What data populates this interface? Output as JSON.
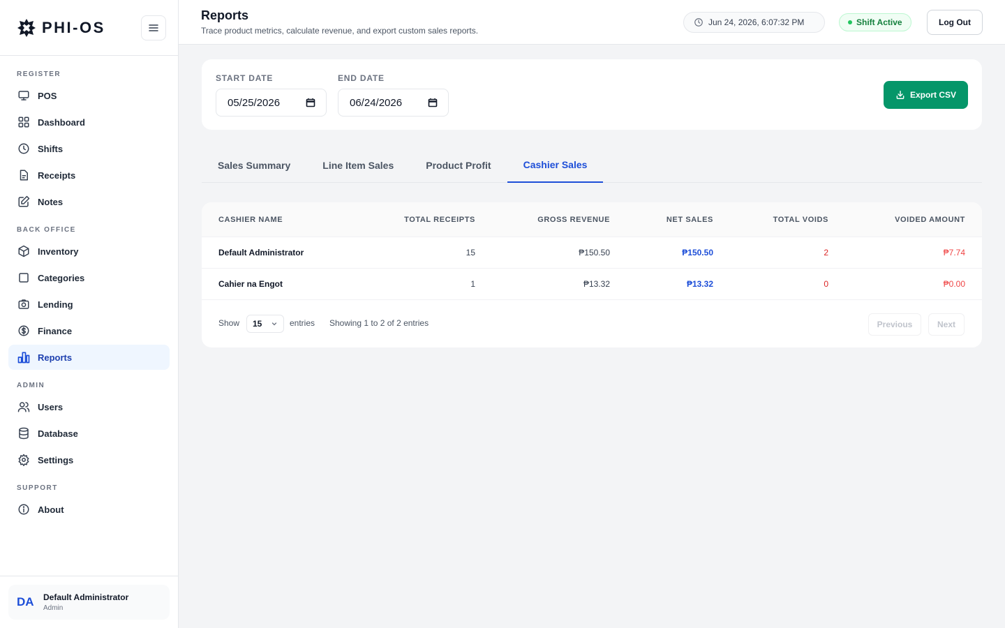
{
  "brand": {
    "name": "PHI-OS"
  },
  "sidebar": {
    "sections": [
      {
        "title": "REGISTER",
        "items": [
          {
            "label": "POS",
            "icon": "monitor-icon"
          },
          {
            "label": "Dashboard",
            "icon": "grid-icon"
          },
          {
            "label": "Shifts",
            "icon": "clock-icon"
          },
          {
            "label": "Receipts",
            "icon": "file-icon"
          },
          {
            "label": "Notes",
            "icon": "edit-icon"
          }
        ]
      },
      {
        "title": "BACK OFFICE",
        "items": [
          {
            "label": "Inventory",
            "icon": "box-icon"
          },
          {
            "label": "Categories",
            "icon": "square-icon"
          },
          {
            "label": "Lending",
            "icon": "camera-icon"
          },
          {
            "label": "Finance",
            "icon": "dollar-icon"
          },
          {
            "label": "Reports",
            "icon": "bar-chart-icon",
            "active": true
          }
        ]
      },
      {
        "title": "ADMIN",
        "items": [
          {
            "label": "Users",
            "icon": "users-icon"
          },
          {
            "label": "Database",
            "icon": "database-icon"
          },
          {
            "label": "Settings",
            "icon": "gear-icon"
          }
        ]
      },
      {
        "title": "SUPPORT",
        "items": [
          {
            "label": "About",
            "icon": "info-icon"
          }
        ]
      }
    ],
    "user": {
      "initials": "DA",
      "name": "Default Administrator",
      "role": "Admin"
    }
  },
  "header": {
    "title": "Reports",
    "subtitle": "Trace product metrics, calculate revenue, and export custom sales reports.",
    "datetime": "Jun 24, 2026, 6:07:32 PM",
    "shift_status": "Shift Active",
    "logout_label": "Log Out"
  },
  "filters": {
    "start_label": "START DATE",
    "start_value": "05/25/2026",
    "end_label": "END DATE",
    "end_value": "06/24/2026",
    "export_label": "Export CSV"
  },
  "tabs": [
    {
      "label": "Sales Summary",
      "active": false
    },
    {
      "label": "Line Item Sales",
      "active": false
    },
    {
      "label": "Product Profit",
      "active": false
    },
    {
      "label": "Cashier Sales",
      "active": true
    }
  ],
  "table": {
    "columns": [
      "CASHIER NAME",
      "TOTAL RECEIPTS",
      "GROSS REVENUE",
      "NET SALES",
      "TOTAL VOIDS",
      "VOIDED AMOUNT"
    ],
    "rows": [
      [
        "Default Administrator",
        "15",
        "₱150.50",
        "₱150.50",
        "2",
        "₱7.74"
      ],
      [
        "Cahier na Engot",
        "1",
        "₱13.32",
        "₱13.32",
        "0",
        "₱0.00"
      ]
    ]
  },
  "pagination": {
    "show_label": "Show",
    "page_size": "15",
    "entries_label": "entries",
    "showing_text": "Showing 1 to 2 of 2 entries",
    "previous_label": "Previous",
    "next_label": "Next"
  },
  "colors": {
    "accent": "#1d4ed8",
    "success": "#059669",
    "danger": "#dc2626"
  }
}
